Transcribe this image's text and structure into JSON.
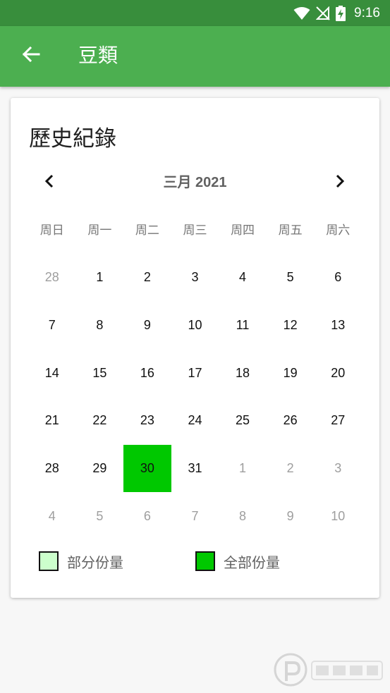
{
  "status_bar": {
    "time": "9:16"
  },
  "app_bar": {
    "title": "豆類"
  },
  "card": {
    "title": "歷史紀錄",
    "month_label": "三月 2021",
    "weekdays": [
      "周日",
      "周一",
      "周二",
      "周三",
      "周四",
      "周五",
      "周六"
    ],
    "days": [
      {
        "label": "28",
        "state": "other"
      },
      {
        "label": "1",
        "state": "current"
      },
      {
        "label": "2",
        "state": "current"
      },
      {
        "label": "3",
        "state": "current"
      },
      {
        "label": "4",
        "state": "current"
      },
      {
        "label": "5",
        "state": "current"
      },
      {
        "label": "6",
        "state": "current"
      },
      {
        "label": "7",
        "state": "current"
      },
      {
        "label": "8",
        "state": "current"
      },
      {
        "label": "9",
        "state": "current"
      },
      {
        "label": "10",
        "state": "current"
      },
      {
        "label": "11",
        "state": "current"
      },
      {
        "label": "12",
        "state": "current"
      },
      {
        "label": "13",
        "state": "current"
      },
      {
        "label": "14",
        "state": "current"
      },
      {
        "label": "15",
        "state": "current"
      },
      {
        "label": "16",
        "state": "current"
      },
      {
        "label": "17",
        "state": "current"
      },
      {
        "label": "18",
        "state": "current"
      },
      {
        "label": "19",
        "state": "current"
      },
      {
        "label": "20",
        "state": "current"
      },
      {
        "label": "21",
        "state": "current"
      },
      {
        "label": "22",
        "state": "current"
      },
      {
        "label": "23",
        "state": "current"
      },
      {
        "label": "24",
        "state": "current"
      },
      {
        "label": "25",
        "state": "current"
      },
      {
        "label": "26",
        "state": "current"
      },
      {
        "label": "27",
        "state": "current"
      },
      {
        "label": "28",
        "state": "current"
      },
      {
        "label": "29",
        "state": "current"
      },
      {
        "label": "30",
        "state": "full"
      },
      {
        "label": "31",
        "state": "current"
      },
      {
        "label": "1",
        "state": "other"
      },
      {
        "label": "2",
        "state": "other"
      },
      {
        "label": "3",
        "state": "other"
      },
      {
        "label": "4",
        "state": "other"
      },
      {
        "label": "5",
        "state": "other"
      },
      {
        "label": "6",
        "state": "other"
      },
      {
        "label": "7",
        "state": "other"
      },
      {
        "label": "8",
        "state": "other"
      },
      {
        "label": "9",
        "state": "other"
      },
      {
        "label": "10",
        "state": "other"
      }
    ],
    "legend": [
      {
        "label": "部分份量",
        "color": "#ccffcc"
      },
      {
        "label": "全部份量",
        "color": "#00c800"
      }
    ]
  },
  "colors": {
    "status_bar": "#388e3c",
    "app_bar": "#4caf50",
    "full_portion": "#00c800",
    "partial_portion": "#ccffcc"
  },
  "icons": {
    "back": "arrow-left-icon",
    "prev": "chevron-left-icon",
    "next": "chevron-right-icon",
    "wifi": "wifi-icon",
    "signal": "no-signal-icon",
    "battery": "battery-charging-icon"
  }
}
